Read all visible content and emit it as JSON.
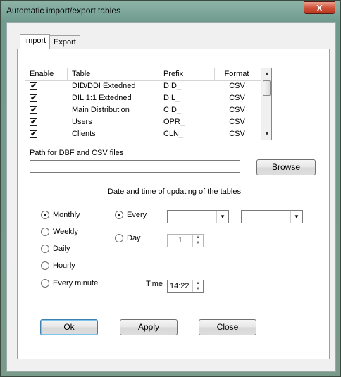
{
  "window": {
    "title": "Automatic import/export tables",
    "close_glyph": "X"
  },
  "tabs": [
    {
      "label": "Import"
    },
    {
      "label": "Export"
    }
  ],
  "table": {
    "columns": [
      "Enable",
      "Table",
      "Prefix",
      "Format"
    ],
    "rows": [
      {
        "enabled": true,
        "table": "DID/DDI Extedned",
        "prefix": "DID_",
        "format": "CSV"
      },
      {
        "enabled": true,
        "table": "DIL 1:1 Extedned",
        "prefix": "DIL_",
        "format": "CSV"
      },
      {
        "enabled": true,
        "table": "Main Distribution",
        "prefix": "CID_",
        "format": "CSV"
      },
      {
        "enabled": true,
        "table": "Users",
        "prefix": "OPR_",
        "format": "CSV"
      },
      {
        "enabled": true,
        "table": "Clients",
        "prefix": "CLN_",
        "format": "CSV"
      }
    ],
    "check_glyph": "✔"
  },
  "path": {
    "label": "Path for DBF and CSV files",
    "value": "",
    "browse_label": "Browse"
  },
  "schedule": {
    "group_title": "Date and time of updating of the tables",
    "frequency": [
      {
        "label": "Monthly",
        "selected": true
      },
      {
        "label": "Weekly",
        "selected": false
      },
      {
        "label": "Daily",
        "selected": false
      },
      {
        "label": "Hourly",
        "selected": false
      },
      {
        "label": "Every minute",
        "selected": false
      }
    ],
    "every_label": "Every",
    "every_selected": true,
    "day_label": "Day",
    "day_selected": false,
    "day_value": "1",
    "combo1_value": "",
    "combo2_value": "",
    "time_label": "Time",
    "time_value": "14:22"
  },
  "buttons": {
    "ok": "Ok",
    "apply": "Apply",
    "close": "Close"
  }
}
